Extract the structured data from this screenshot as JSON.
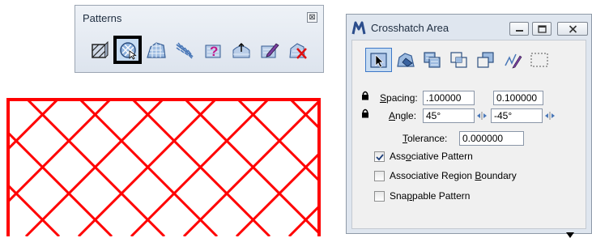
{
  "patterns_toolbox": {
    "title": "Patterns",
    "close_glyph": "⊠",
    "tools": [
      {
        "name": "hatch-area-icon"
      },
      {
        "name": "crosshatch-area-icon",
        "active": true
      },
      {
        "name": "pattern-area-icon"
      },
      {
        "name": "linear-pattern-icon"
      },
      {
        "name": "show-pattern-attributes-icon"
      },
      {
        "name": "match-pattern-attributes-icon"
      },
      {
        "name": "change-pattern-icon"
      },
      {
        "name": "delete-pattern-icon"
      }
    ]
  },
  "dialog": {
    "title": "Crosshatch Area",
    "title_icon": "microstation-m-icon",
    "method_tools": [
      {
        "name": "element-method-icon",
        "active": true
      },
      {
        "name": "flood-method-icon"
      },
      {
        "name": "union-method-icon"
      },
      {
        "name": "intersection-method-icon"
      },
      {
        "name": "difference-method-icon"
      },
      {
        "name": "points-method-icon"
      },
      {
        "name": "fence-method-icon"
      }
    ],
    "spacing_label": "Spacing:",
    "spacing_value_1": ".100000",
    "spacing_value_2": "0.100000",
    "angle_label": "Angle:",
    "angle_value_1": "45°",
    "angle_value_2": "-45°",
    "tolerance_label": "Tolerance:",
    "tolerance_value": "0.000000",
    "options": [
      {
        "label": "Associative Pattern",
        "checked": true
      },
      {
        "label": "Associative Region Boundary",
        "checked": false
      },
      {
        "label": "Snappable Pattern",
        "checked": false
      }
    ]
  },
  "colors": {
    "hatch_line": "#ff0000",
    "active_highlight": "#c7dcf2",
    "icon_blue": "#4a78b8"
  }
}
